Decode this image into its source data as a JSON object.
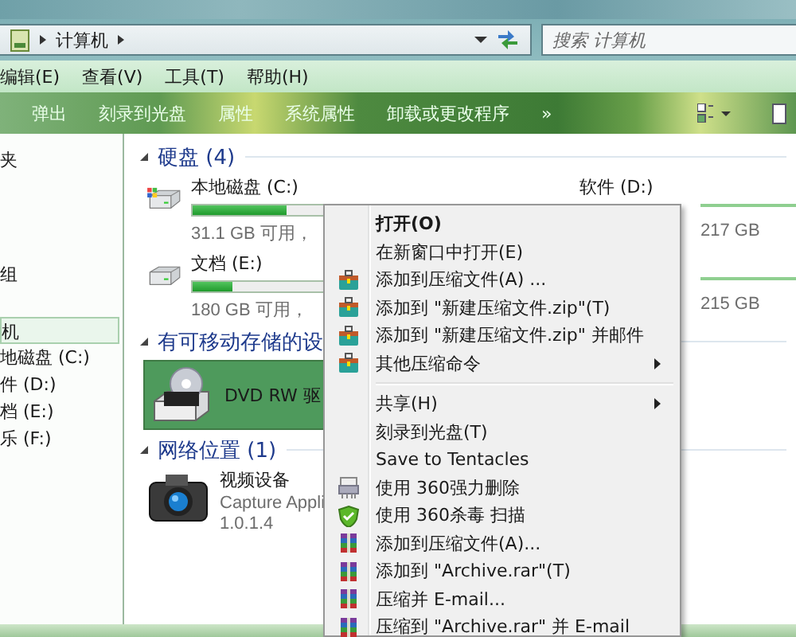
{
  "address_bar": {
    "crumbs": [
      "计算机"
    ]
  },
  "search": {
    "placeholder": "搜索 计算机"
  },
  "menu_bar": [
    "编辑(E)",
    "查看(V)",
    "工具(T)",
    "帮助(H)"
  ],
  "toolbar": [
    "弹出",
    "刻录到光盘",
    "属性",
    "系统属性",
    "卸载或更改程序",
    "»"
  ],
  "sidebar": {
    "items": [
      {
        "label": "夹",
        "selected": false
      },
      {
        "label": "组",
        "selected": false
      },
      {
        "label": "机",
        "selected": true
      },
      {
        "label": "地磁盘 (C:)",
        "selected": false
      },
      {
        "label": "件 (D:)",
        "selected": false
      },
      {
        "label": "档 (E:)",
        "selected": false
      },
      {
        "label": "乐 (F:)",
        "selected": false
      }
    ]
  },
  "groups": [
    {
      "title": "硬盘 (4)",
      "items": [
        {
          "kind": "system-disk",
          "label": "本地磁盘 (C:)",
          "level": 0.33,
          "free": "31.1 GB 可用，"
        },
        {
          "kind": "disk-tail",
          "label": "软件 (D:)",
          "total": "217 GB"
        },
        {
          "kind": "disk",
          "label": "文档 (E:)",
          "level": 0.14,
          "free": "180 GB 可用，"
        },
        {
          "kind": "disk-tail",
          "total": "215 GB"
        }
      ]
    },
    {
      "title": "有可移动存储的设",
      "items": [
        {
          "kind": "dvd",
          "label": "DVD RW 驱",
          "selected": true
        }
      ]
    },
    {
      "title": "网络位置 (1)",
      "items": [
        {
          "kind": "camera",
          "label": "视频设备",
          "sub": "Capture Appli",
          "version": "1.0.1.4"
        }
      ]
    }
  ],
  "context_menu": {
    "items": [
      {
        "kind": "plain",
        "label": "打开(O)",
        "bold": true
      },
      {
        "kind": "plain",
        "label": "在新窗口中打开(E)",
        "bold": false
      },
      {
        "kind": "archive",
        "label": "添加到压缩文件(A) ...",
        "bold": false
      },
      {
        "kind": "archive",
        "label": "添加到 \"新建压缩文件.zip\"(T)",
        "bold": false
      },
      {
        "kind": "archive",
        "label": "添加到 \"新建压缩文件.zip\" 并邮件",
        "bold": false
      },
      {
        "kind": "archive",
        "label": "其他压缩命令",
        "bold": false,
        "submenu": true
      },
      {
        "kind": "separator"
      },
      {
        "kind": "plain",
        "label": "共享(H)",
        "bold": false,
        "submenu": true
      },
      {
        "kind": "plain",
        "label": "刻录到光盘(T)",
        "bold": false
      },
      {
        "kind": "plain",
        "label": "Save to Tentacles",
        "bold": false
      },
      {
        "kind": "shred",
        "label": "使用 360强力删除",
        "bold": false
      },
      {
        "kind": "scan",
        "label": "使用 360杀毒 扫描",
        "bold": false
      },
      {
        "kind": "rar",
        "label": "添加到压缩文件(A)...",
        "bold": false
      },
      {
        "kind": "rar",
        "label": "添加到 \"Archive.rar\"(T)",
        "bold": false
      },
      {
        "kind": "rar",
        "label": "压缩并 E-mail...",
        "bold": false
      },
      {
        "kind": "rar",
        "label": "压缩到 \"Archive.rar\" 并 E-mail",
        "bold": false
      }
    ]
  }
}
